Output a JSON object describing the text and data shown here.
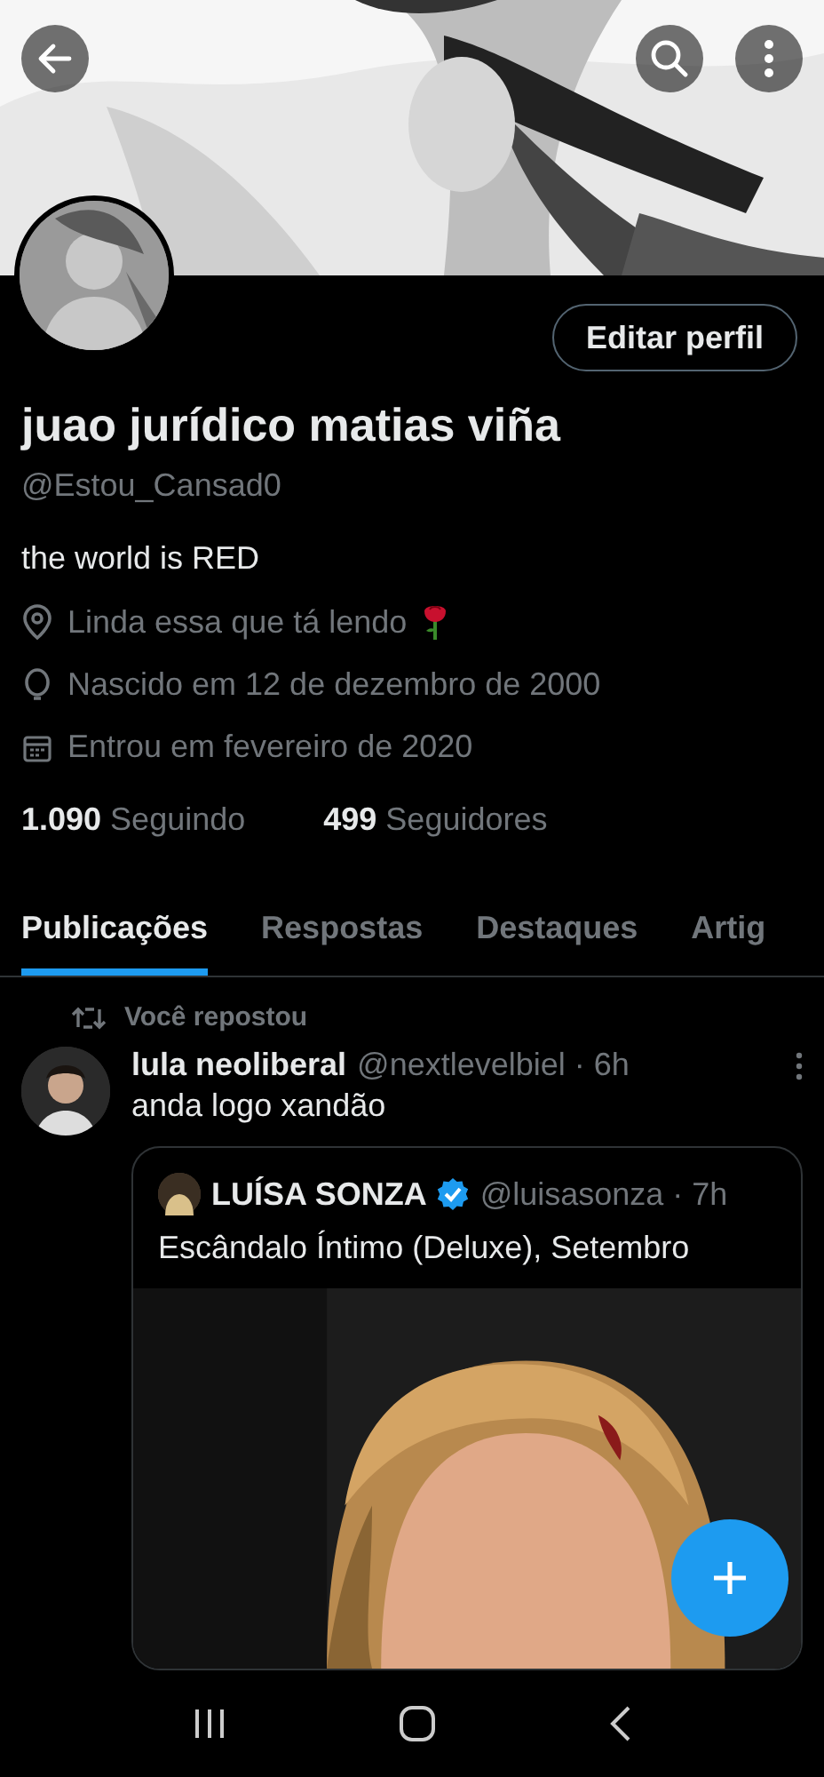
{
  "profile": {
    "edit_button": "Editar perfil",
    "name": "juao jurídico matias viña",
    "handle": "@Estou_Cansad0",
    "bio": "the world is RED",
    "details": [
      {
        "kind": "location",
        "text": "Linda essa que tá lendo",
        "rose": true
      },
      {
        "kind": "birthday",
        "text": "Nascido em 12 de dezembro de 2000"
      },
      {
        "kind": "joined",
        "text": "Entrou em fevereiro de 2020"
      }
    ],
    "stats": [
      {
        "value": "1.090",
        "label": "Seguindo"
      },
      {
        "value": "499",
        "label": "Seguidores"
      }
    ]
  },
  "tabs": [
    {
      "label": "Publicações",
      "selected": true
    },
    {
      "label": "Respostas",
      "selected": false
    },
    {
      "label": "Destaques",
      "selected": false
    },
    {
      "label": "Artig",
      "selected": false
    }
  ],
  "posts": [
    {
      "repost_label": "Você repostou",
      "author": "lula neoliberal",
      "meta": "@nextlevelbiel · 6h",
      "text": "anda logo xandão",
      "quote": {
        "author": "LUÍSA SONZA",
        "verified": true,
        "meta": "@luisasonza · 7h",
        "text": "Escândalo Íntimo (Deluxe), Setembro"
      }
    }
  ]
}
